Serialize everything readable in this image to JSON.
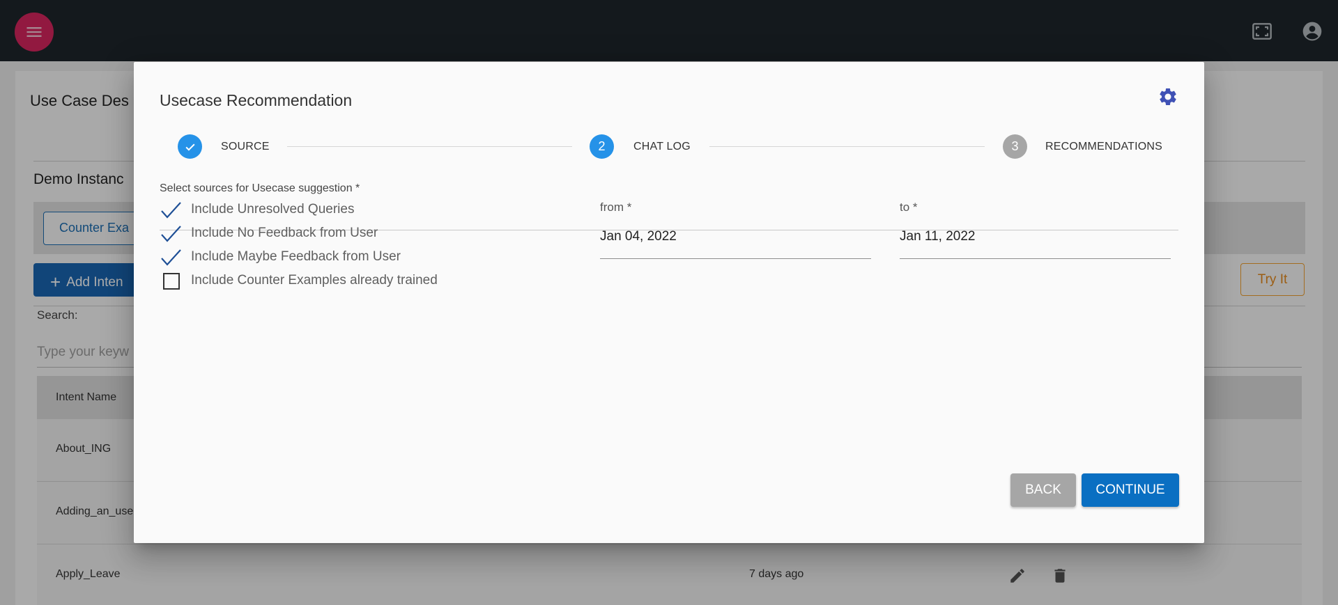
{
  "colors": {
    "topbar": "#1e262b",
    "menu_button": "#d8265f",
    "step_active": "#2592e8",
    "step_inactive": "#a6a6a6",
    "primary_button": "#0a6fc2",
    "secondary_button": "#a6a6a6",
    "try_it_accent": "#e58a1c"
  },
  "topbar": {
    "menu_icon": "menu-icon",
    "fullscreen_icon": "fullscreen-icon",
    "account_icon": "account-circle-icon"
  },
  "background": {
    "page_title": "Use Case Des",
    "section_title": "Demo Instanc",
    "counter_tab": "Counter Exa",
    "add_intent_button": "Add Inten",
    "try_it_button": "Try It",
    "search_label": "Search:",
    "search_placeholder": "Type your keyw",
    "table_header": "Intent Name",
    "rows": [
      {
        "name": "About_ING",
        "date": ""
      },
      {
        "name": "Adding_an_user",
        "date": ""
      },
      {
        "name": "Apply_Leave",
        "date": "7 days ago"
      }
    ]
  },
  "dialog": {
    "title": "Usecase Recommendation",
    "settings_icon": "settings-icon",
    "steps": [
      {
        "number": "✓",
        "label": "SOURCE",
        "state": "completed"
      },
      {
        "number": "2",
        "label": "CHAT LOG",
        "state": "active"
      },
      {
        "number": "3",
        "label": "RECOMMENDATIONS",
        "state": "inactive"
      }
    ],
    "sources_label": "Select sources for Usecase suggestion *",
    "sources": [
      {
        "label": "Include Unresolved Queries",
        "checked": true
      },
      {
        "label": "Include No Feedback from User",
        "checked": true
      },
      {
        "label": "Include Maybe Feedback from User",
        "checked": true
      },
      {
        "label": "Include Counter Examples already trained",
        "checked": false
      }
    ],
    "from": {
      "label": "from *",
      "value": "Jan 04, 2022"
    },
    "to": {
      "label": "to *",
      "value": "Jan 11, 2022"
    },
    "back_button": "BACK",
    "continue_button": "CONTINUE"
  }
}
